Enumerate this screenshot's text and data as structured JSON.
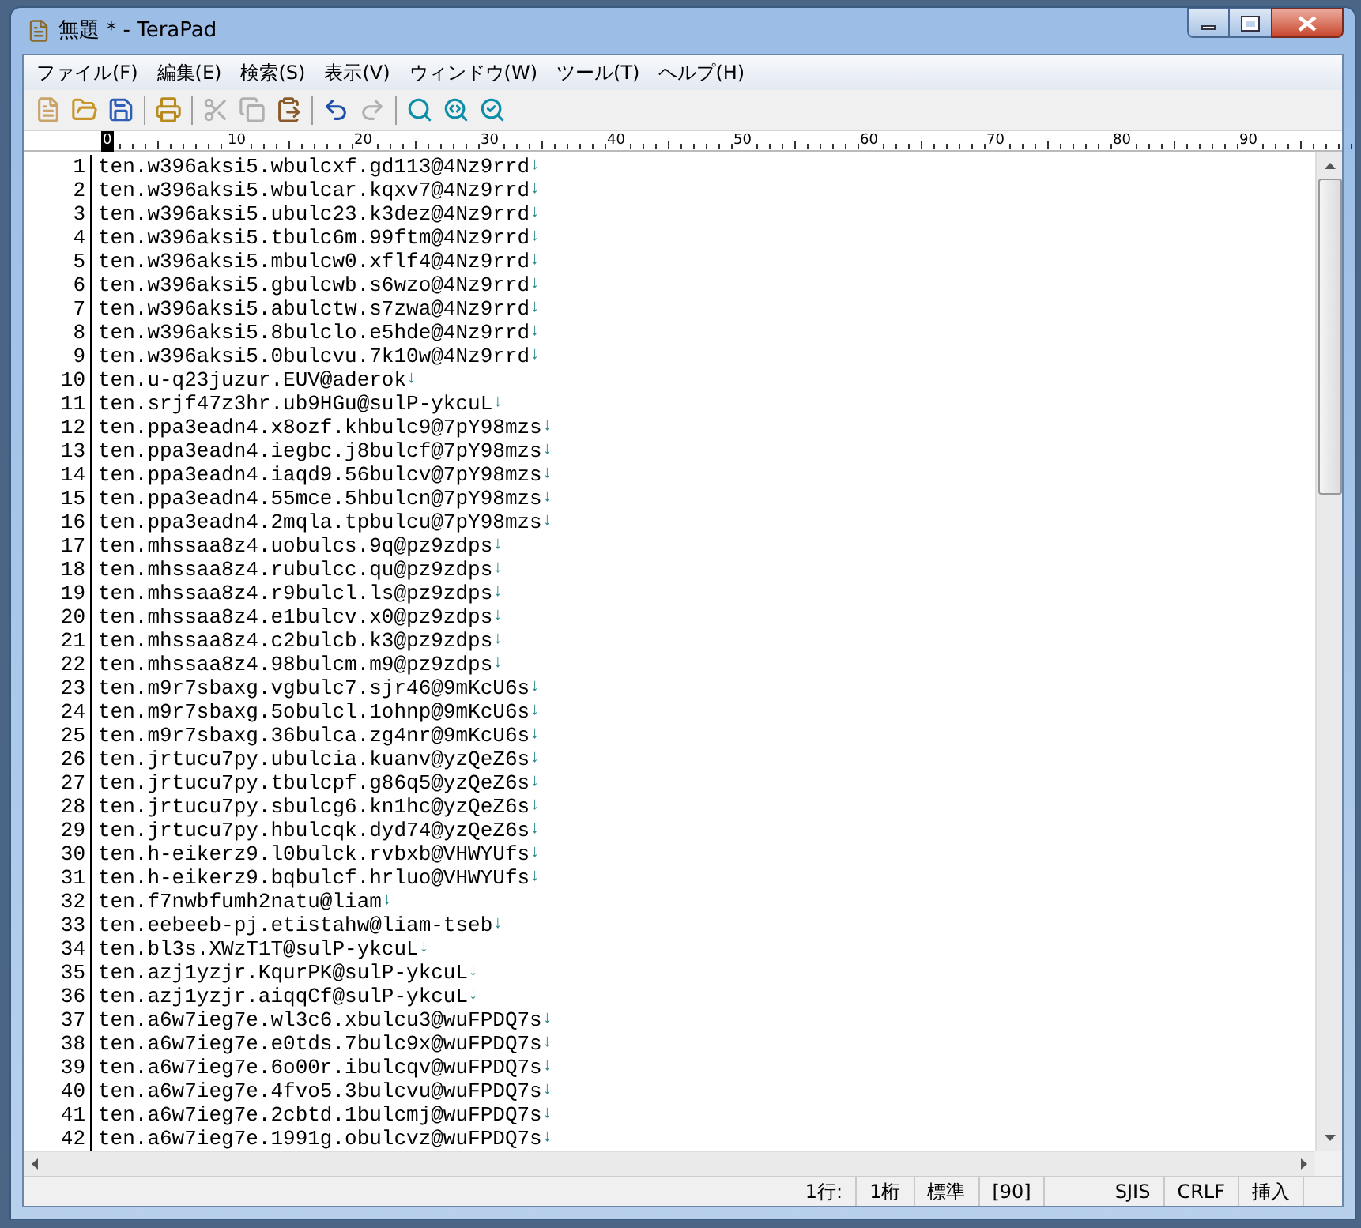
{
  "window": {
    "title": "無題 * - TeraPad"
  },
  "menu": [
    "ファイル(F)",
    "編集(E)",
    "検索(S)",
    "表示(V)",
    "ウィンドウ(W)",
    "ツール(T)",
    "ヘルプ(H)"
  ],
  "toolbar": [
    [
      {
        "disabled": false
      },
      {
        "disabled": false
      },
      {
        "disabled": false
      }
    ],
    [
      {
        "disabled": false
      }
    ],
    [
      {
        "disabled": true
      },
      {
        "disabled": true
      },
      {
        "disabled": false
      }
    ],
    [
      {
        "disabled": false
      },
      {
        "disabled": true
      }
    ],
    [
      {
        "disabled": false
      },
      {
        "disabled": false
      },
      {
        "disabled": false
      }
    ]
  ],
  "ruler": [
    "0",
    "10",
    "20",
    "30",
    "40",
    "50",
    "60",
    "70",
    "80",
    "90"
  ],
  "lines": [
    {
      "number": "1",
      "text": "ten.w396aksi5.wbulcxf.gd113@4Nz9rrd",
      "eol": "↓"
    },
    {
      "number": "2",
      "text": "ten.w396aksi5.wbulcar.kqxv7@4Nz9rrd",
      "eol": "↓"
    },
    {
      "number": "3",
      "text": "ten.w396aksi5.ubulc23.k3dez@4Nz9rrd",
      "eol": "↓"
    },
    {
      "number": "4",
      "text": "ten.w396aksi5.tbulc6m.99ftm@4Nz9rrd",
      "eol": "↓"
    },
    {
      "number": "5",
      "text": "ten.w396aksi5.mbulcw0.xflf4@4Nz9rrd",
      "eol": "↓"
    },
    {
      "number": "6",
      "text": "ten.w396aksi5.gbulcwb.s6wzo@4Nz9rrd",
      "eol": "↓"
    },
    {
      "number": "7",
      "text": "ten.w396aksi5.abulctw.s7zwa@4Nz9rrd",
      "eol": "↓"
    },
    {
      "number": "8",
      "text": "ten.w396aksi5.8bulclo.e5hde@4Nz9rrd",
      "eol": "↓"
    },
    {
      "number": "9",
      "text": "ten.w396aksi5.0bulcvu.7k10w@4Nz9rrd",
      "eol": "↓"
    },
    {
      "number": "10",
      "text": "ten.u-q23juzur.EUV@aderok",
      "eol": "↓"
    },
    {
      "number": "11",
      "text": "ten.srjf47z3hr.ub9HGu@sulP-ykcuL",
      "eol": "↓"
    },
    {
      "number": "12",
      "text": "ten.ppa3eadn4.x8ozf.khbulc9@7pY98mzs",
      "eol": "↓"
    },
    {
      "number": "13",
      "text": "ten.ppa3eadn4.iegbc.j8bulcf@7pY98mzs",
      "eol": "↓"
    },
    {
      "number": "14",
      "text": "ten.ppa3eadn4.iaqd9.56bulcv@7pY98mzs",
      "eol": "↓"
    },
    {
      "number": "15",
      "text": "ten.ppa3eadn4.55mce.5hbulcn@7pY98mzs",
      "eol": "↓"
    },
    {
      "number": "16",
      "text": "ten.ppa3eadn4.2mqla.tpbulcu@7pY98mzs",
      "eol": "↓"
    },
    {
      "number": "17",
      "text": "ten.mhssaa8z4.uobulcs.9q@pz9zdps",
      "eol": "↓"
    },
    {
      "number": "18",
      "text": "ten.mhssaa8z4.rubulcc.qu@pz9zdps",
      "eol": "↓"
    },
    {
      "number": "19",
      "text": "ten.mhssaa8z4.r9bulcl.ls@pz9zdps",
      "eol": "↓"
    },
    {
      "number": "20",
      "text": "ten.mhssaa8z4.e1bulcv.x0@pz9zdps",
      "eol": "↓"
    },
    {
      "number": "21",
      "text": "ten.mhssaa8z4.c2bulcb.k3@pz9zdps",
      "eol": "↓"
    },
    {
      "number": "22",
      "text": "ten.mhssaa8z4.98bulcm.m9@pz9zdps",
      "eol": "↓"
    },
    {
      "number": "23",
      "text": "ten.m9r7sbaxg.vgbulc7.sjr46@9mKcU6s",
      "eol": "↓"
    },
    {
      "number": "24",
      "text": "ten.m9r7sbaxg.5obulcl.1ohnp@9mKcU6s",
      "eol": "↓"
    },
    {
      "number": "25",
      "text": "ten.m9r7sbaxg.36bulca.zg4nr@9mKcU6s",
      "eol": "↓"
    },
    {
      "number": "26",
      "text": "ten.jrtucu7py.ubulcia.kuanv@yzQeZ6s",
      "eol": "↓"
    },
    {
      "number": "27",
      "text": "ten.jrtucu7py.tbulcpf.g86q5@yzQeZ6s",
      "eol": "↓"
    },
    {
      "number": "28",
      "text": "ten.jrtucu7py.sbulcg6.kn1hc@yzQeZ6s",
      "eol": "↓"
    },
    {
      "number": "29",
      "text": "ten.jrtucu7py.hbulcqk.dyd74@yzQeZ6s",
      "eol": "↓"
    },
    {
      "number": "30",
      "text": "ten.h-eikerz9.l0bulck.rvbxb@VHWYUfs",
      "eol": "↓"
    },
    {
      "number": "31",
      "text": "ten.h-eikerz9.bqbulcf.hrluo@VHWYUfs",
      "eol": "↓"
    },
    {
      "number": "32",
      "text": "ten.f7nwbfumh2natu@liam",
      "eol": "↓"
    },
    {
      "number": "33",
      "text": "ten.eebeeb-pj.etistahw@liam-tseb",
      "eol": "↓"
    },
    {
      "number": "34",
      "text": "ten.bl3s.XWzT1T@sulP-ykcuL",
      "eol": "↓"
    },
    {
      "number": "35",
      "text": "ten.azj1yzjr.KqurPK@sulP-ykcuL",
      "eol": "↓"
    },
    {
      "number": "36",
      "text": "ten.azj1yzjr.aiqqCf@sulP-ykcuL",
      "eol": "↓"
    },
    {
      "number": "37",
      "text": "ten.a6w7ieg7e.wl3c6.xbulcu3@wuFPDQ7s",
      "eol": "↓"
    },
    {
      "number": "38",
      "text": "ten.a6w7ieg7e.e0tds.7bulc9x@wuFPDQ7s",
      "eol": "↓"
    },
    {
      "number": "39",
      "text": "ten.a6w7ieg7e.6o00r.ibulcqv@wuFPDQ7s",
      "eol": "↓"
    },
    {
      "number": "40",
      "text": "ten.a6w7ieg7e.4fvo5.3bulcvu@wuFPDQ7s",
      "eol": "↓"
    },
    {
      "number": "41",
      "text": "ten.a6w7ieg7e.2cbtd.1bulcmj@wuFPDQ7s",
      "eol": "↓"
    },
    {
      "number": "42",
      "text": "ten.a6w7ieg7e.1991g.obulcvz@wuFPDQ7s",
      "eol": "↓"
    }
  ],
  "status_bar": [
    "1行:",
    "1桁",
    "標準",
    "[90]",
    "SJIS",
    "CRLF",
    "挿入"
  ]
}
